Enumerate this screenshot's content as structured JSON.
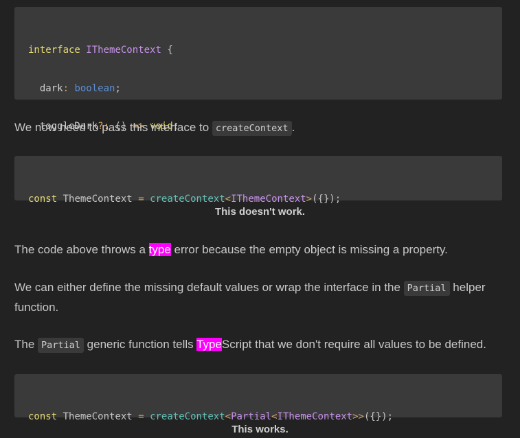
{
  "code_block_1": {
    "line1": {
      "kw": "interface",
      "name": "IThemeContext",
      "brace": "{"
    },
    "line2": {
      "prop": "dark",
      "colon": ":",
      "type": "boolean",
      "semi": ";"
    },
    "line3": {
      "prop": "toggleDark",
      "optional": "?:",
      "parens": "()",
      "arrow": "=>",
      "ret": "void",
      "semi": ";"
    },
    "line4": {
      "brace": "}"
    }
  },
  "para_1": {
    "text": "We now need to pass this interface to ",
    "code": "createContext",
    "end": "."
  },
  "code_block_2": {
    "kw": "const",
    "name": "ThemeContext",
    "eq": "=",
    "fn": "createContext",
    "lt": "<",
    "type": "IThemeContext",
    "gt": ">",
    "args": "({});"
  },
  "caption_1": "This doesn't work.",
  "para_2": {
    "before": "The code above throws a ",
    "highlight": "type",
    "after": " error because the empty object is missing a property."
  },
  "para_3": {
    "before": "We can either define the missing default values or wrap the interface in the ",
    "code": "Partial",
    "after": " helper function."
  },
  "para_4": {
    "before": "The ",
    "code": "Partial",
    "middle": " generic function tells ",
    "highlight": "Type",
    "after": "Script that we don't require all values to be defined."
  },
  "code_block_3": {
    "kw": "const",
    "name": "ThemeContext",
    "eq": "=",
    "fn": "createContext",
    "lt1": "<",
    "partial": "Partial",
    "lt2": "<",
    "type": "IThemeContext",
    "gt": ">>",
    "args": "({});"
  },
  "caption_2": "This works.",
  "colors": {
    "background": "#222222",
    "code_background": "#3a3a3a",
    "highlight": "#ff00ff",
    "keyword": "#e6db74",
    "type": "#c792ea",
    "function": "#61c1b8",
    "boolean": "#5c8fd6"
  }
}
